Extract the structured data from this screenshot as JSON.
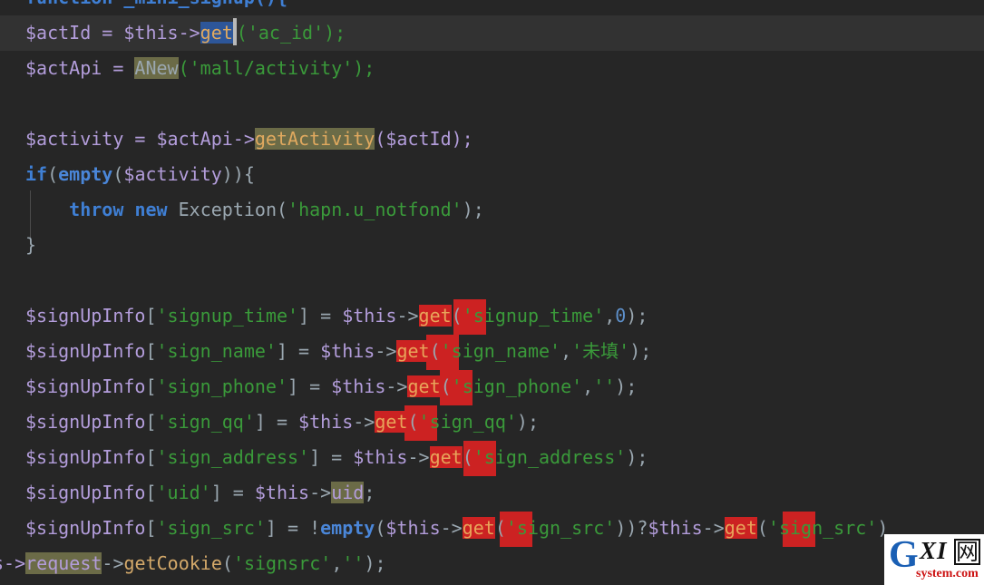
{
  "editor": {
    "language": "PHP",
    "background": "#262626",
    "current_line_background": "#323232",
    "selection_background": "#2d5699",
    "occurrence_highlight": "#cc2222",
    "identifier_highlight": "#6b6b47",
    "font_size_px": 20,
    "line_height_px": 39,
    "current_line_index": 1,
    "caret_after_token": "get"
  },
  "colors": {
    "variable": "#b39ddb",
    "keyword": "#3f7fd4",
    "string": "#3a9a3a",
    "number": "#5d8fc9",
    "function": "#d4a96a",
    "punctuation": "#9aa7b0",
    "default_text": "#a9b7c6"
  },
  "code": {
    "line_01": "function _mini_signup(){",
    "line_02_a": "$actId = $this->",
    "line_02_sel": "get",
    "line_02_b": "('ac_id');",
    "line_03_a": "$actApi = ",
    "line_03_hl": "ANew",
    "line_03_b": "('mall/activity');",
    "line_04": "",
    "line_05_a": "$activity = $actApi->",
    "line_05_hl": "getActivity",
    "line_05_b": "($actId);",
    "line_06_kw1": "if",
    "line_06_p1": "(",
    "line_06_kw2": "empty",
    "line_06_p2": "(",
    "line_06_var": "$activity",
    "line_06_p3": ")){",
    "line_07_kw1": "throw",
    "line_07_kw2": "new",
    "line_07_cls": "Exception",
    "line_07_p1": "(",
    "line_07_str": "'hapn.u_notfond'",
    "line_07_p2": ");",
    "line_08": "}",
    "line_09": "",
    "line_10_var": "$signUpInfo",
    "line_10_b1": "[",
    "line_10_key": "'signup_time'",
    "line_10_b2": "]",
    "line_10_eq": " = ",
    "line_10_this": "$this",
    "line_10_arrow": "->",
    "line_10_get": "get",
    "line_10_p1": "(",
    "line_10_arg1": "'signup_time'",
    "line_10_comma": ",",
    "line_10_arg2": "0",
    "line_10_p2": ");",
    "line_11_var": "$signUpInfo",
    "line_11_key": "'sign_name'",
    "line_11_get": "get",
    "line_11_arg1": "'sign_name'",
    "line_11_arg2": "'未填'",
    "line_12_var": "$signUpInfo",
    "line_12_key": "'sign_phone'",
    "line_12_get": "get",
    "line_12_arg1": "'sign_phone'",
    "line_12_arg2": "''",
    "line_13_var": "$signUpInfo",
    "line_13_key": "'sign_qq'",
    "line_13_get": "get",
    "line_13_arg1": "'sign_qq'",
    "line_14_var": "$signUpInfo",
    "line_14_key": "'sign_address'",
    "line_14_get": "get",
    "line_14_arg1": "'sign_address'",
    "line_15_var": "$signUpInfo",
    "line_15_key": "'uid'",
    "line_15_this": "$this",
    "line_15_prop": "uid",
    "line_15_end": ";",
    "line_16_var": "$signUpInfo",
    "line_16_key": "'sign_src'",
    "line_16_bang": "!",
    "line_16_kw": "empty",
    "line_16_this1": "$this",
    "line_16_get1": "get",
    "line_16_arg1": "'sign_src'",
    "line_16_tern": "))?",
    "line_16_this2": "$this",
    "line_16_get2": "get",
    "line_16_arg2": "'sign_src'",
    "line_16_tail": ")",
    "line_17_pre": "s->",
    "line_17_hl": "request",
    "line_17_arrow": "->",
    "line_17_fn": "getCookie",
    "line_17_p1": "(",
    "line_17_arg1": "'signsrc'",
    "line_17_comma": ",",
    "line_17_arg2": "''",
    "line_17_p2": ");"
  },
  "watermark": {
    "letter_g": "G",
    "letters_xi": "XI",
    "cjk": "网",
    "domain": "system.com",
    "g_color": "#1a5fb4",
    "domain_color": "#cc1111"
  }
}
